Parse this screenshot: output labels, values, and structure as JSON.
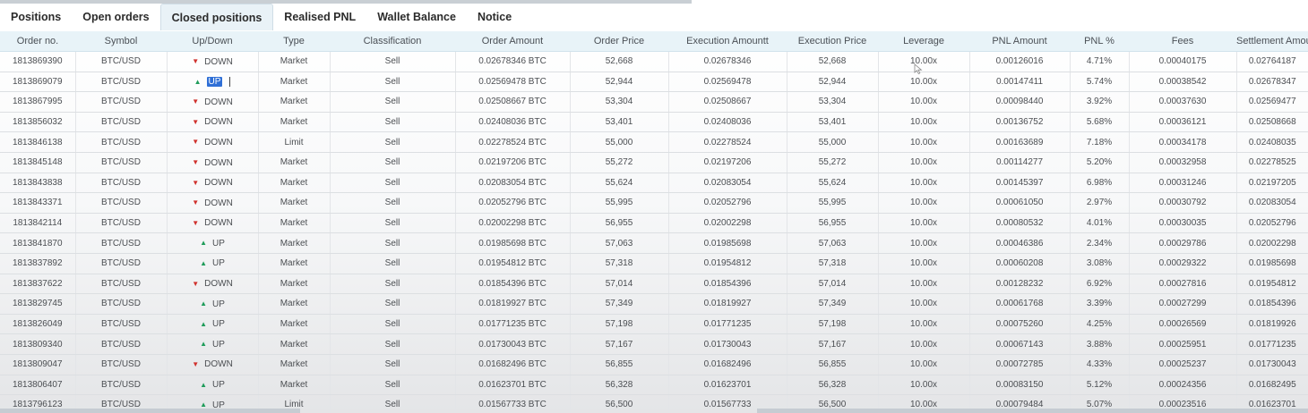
{
  "tabs": [
    {
      "label": "Positions",
      "active": false
    },
    {
      "label": "Open orders",
      "active": false
    },
    {
      "label": "Closed positions",
      "active": true
    },
    {
      "label": "Realised PNL",
      "active": false
    },
    {
      "label": "Wallet Balance",
      "active": false
    },
    {
      "label": "Notice",
      "active": false
    }
  ],
  "columns": [
    "Order no.",
    "Symbol",
    "Up/Down",
    "Type",
    "Classification",
    "Order Amount",
    "Order Price",
    "Execution Amountt",
    "Execution Price",
    "Leverage",
    "PNL Amount",
    "PNL %",
    "Fees",
    "Settlement Amount"
  ],
  "direction_colors": {
    "up": "#1f9c5a",
    "down": "#d0312d"
  },
  "rows": [
    {
      "order_no": "1813869390",
      "symbol": "BTC/USD",
      "dir": "DOWN",
      "type": "Market",
      "classification": "Sell",
      "order_amount": "0.02678346 BTC",
      "order_price": "52,668",
      "exec_amount": "0.02678346",
      "exec_price": "52,668",
      "leverage": "10.00x",
      "pnl_amount": "0.00126016",
      "pnl_pct": "4.71%",
      "fees": "0.00040175",
      "settlement": "0.02764187"
    },
    {
      "order_no": "1813869079",
      "symbol": "BTC/USD",
      "dir": "UP",
      "type": "Market",
      "classification": "Sell",
      "order_amount": "0.02569478 BTC",
      "order_price": "52,944",
      "exec_amount": "0.02569478",
      "exec_price": "52,944",
      "leverage": "10.00x",
      "pnl_amount": "0.00147411",
      "pnl_pct": "5.74%",
      "fees": "0.00038542",
      "settlement": "0.02678347"
    },
    {
      "order_no": "1813867995",
      "symbol": "BTC/USD",
      "dir": "DOWN",
      "type": "Market",
      "classification": "Sell",
      "order_amount": "0.02508667 BTC",
      "order_price": "53,304",
      "exec_amount": "0.02508667",
      "exec_price": "53,304",
      "leverage": "10.00x",
      "pnl_amount": "0.00098440",
      "pnl_pct": "3.92%",
      "fees": "0.00037630",
      "settlement": "0.02569477"
    },
    {
      "order_no": "1813856032",
      "symbol": "BTC/USD",
      "dir": "DOWN",
      "type": "Market",
      "classification": "Sell",
      "order_amount": "0.02408036 BTC",
      "order_price": "53,401",
      "exec_amount": "0.02408036",
      "exec_price": "53,401",
      "leverage": "10.00x",
      "pnl_amount": "0.00136752",
      "pnl_pct": "5.68%",
      "fees": "0.00036121",
      "settlement": "0.02508668"
    },
    {
      "order_no": "1813846138",
      "symbol": "BTC/USD",
      "dir": "DOWN",
      "type": "Limit",
      "classification": "Sell",
      "order_amount": "0.02278524 BTC",
      "order_price": "55,000",
      "exec_amount": "0.02278524",
      "exec_price": "55,000",
      "leverage": "10.00x",
      "pnl_amount": "0.00163689",
      "pnl_pct": "7.18%",
      "fees": "0.00034178",
      "settlement": "0.02408035"
    },
    {
      "order_no": "1813845148",
      "symbol": "BTC/USD",
      "dir": "DOWN",
      "type": "Market",
      "classification": "Sell",
      "order_amount": "0.02197206 BTC",
      "order_price": "55,272",
      "exec_amount": "0.02197206",
      "exec_price": "55,272",
      "leverage": "10.00x",
      "pnl_amount": "0.00114277",
      "pnl_pct": "5.20%",
      "fees": "0.00032958",
      "settlement": "0.02278525"
    },
    {
      "order_no": "1813843838",
      "symbol": "BTC/USD",
      "dir": "DOWN",
      "type": "Market",
      "classification": "Sell",
      "order_amount": "0.02083054 BTC",
      "order_price": "55,624",
      "exec_amount": "0.02083054",
      "exec_price": "55,624",
      "leverage": "10.00x",
      "pnl_amount": "0.00145397",
      "pnl_pct": "6.98%",
      "fees": "0.00031246",
      "settlement": "0.02197205"
    },
    {
      "order_no": "1813843371",
      "symbol": "BTC/USD",
      "dir": "DOWN",
      "type": "Market",
      "classification": "Sell",
      "order_amount": "0.02052796 BTC",
      "order_price": "55,995",
      "exec_amount": "0.02052796",
      "exec_price": "55,995",
      "leverage": "10.00x",
      "pnl_amount": "0.00061050",
      "pnl_pct": "2.97%",
      "fees": "0.00030792",
      "settlement": "0.02083054"
    },
    {
      "order_no": "1813842114",
      "symbol": "BTC/USD",
      "dir": "DOWN",
      "type": "Market",
      "classification": "Sell",
      "order_amount": "0.02002298 BTC",
      "order_price": "56,955",
      "exec_amount": "0.02002298",
      "exec_price": "56,955",
      "leverage": "10.00x",
      "pnl_amount": "0.00080532",
      "pnl_pct": "4.01%",
      "fees": "0.00030035",
      "settlement": "0.02052796"
    },
    {
      "order_no": "1813841870",
      "symbol": "BTC/USD",
      "dir": "UP",
      "type": "Market",
      "classification": "Sell",
      "order_amount": "0.01985698 BTC",
      "order_price": "57,063",
      "exec_amount": "0.01985698",
      "exec_price": "57,063",
      "leverage": "10.00x",
      "pnl_amount": "0.00046386",
      "pnl_pct": "2.34%",
      "fees": "0.00029786",
      "settlement": "0.02002298"
    },
    {
      "order_no": "1813837892",
      "symbol": "BTC/USD",
      "dir": "UP",
      "type": "Market",
      "classification": "Sell",
      "order_amount": "0.01954812 BTC",
      "order_price": "57,318",
      "exec_amount": "0.01954812",
      "exec_price": "57,318",
      "leverage": "10.00x",
      "pnl_amount": "0.00060208",
      "pnl_pct": "3.08%",
      "fees": "0.00029322",
      "settlement": "0.01985698"
    },
    {
      "order_no": "1813837622",
      "symbol": "BTC/USD",
      "dir": "DOWN",
      "type": "Market",
      "classification": "Sell",
      "order_amount": "0.01854396 BTC",
      "order_price": "57,014",
      "exec_amount": "0.01854396",
      "exec_price": "57,014",
      "leverage": "10.00x",
      "pnl_amount": "0.00128232",
      "pnl_pct": "6.92%",
      "fees": "0.00027816",
      "settlement": "0.01954812"
    },
    {
      "order_no": "1813829745",
      "symbol": "BTC/USD",
      "dir": "UP",
      "type": "Market",
      "classification": "Sell",
      "order_amount": "0.01819927 BTC",
      "order_price": "57,349",
      "exec_amount": "0.01819927",
      "exec_price": "57,349",
      "leverage": "10.00x",
      "pnl_amount": "0.00061768",
      "pnl_pct": "3.39%",
      "fees": "0.00027299",
      "settlement": "0.01854396"
    },
    {
      "order_no": "1813826049",
      "symbol": "BTC/USD",
      "dir": "UP",
      "type": "Market",
      "classification": "Sell",
      "order_amount": "0.01771235 BTC",
      "order_price": "57,198",
      "exec_amount": "0.01771235",
      "exec_price": "57,198",
      "leverage": "10.00x",
      "pnl_amount": "0.00075260",
      "pnl_pct": "4.25%",
      "fees": "0.00026569",
      "settlement": "0.01819926"
    },
    {
      "order_no": "1813809340",
      "symbol": "BTC/USD",
      "dir": "UP",
      "type": "Market",
      "classification": "Sell",
      "order_amount": "0.01730043 BTC",
      "order_price": "57,167",
      "exec_amount": "0.01730043",
      "exec_price": "57,167",
      "leverage": "10.00x",
      "pnl_amount": "0.00067143",
      "pnl_pct": "3.88%",
      "fees": "0.00025951",
      "settlement": "0.01771235"
    },
    {
      "order_no": "1813809047",
      "symbol": "BTC/USD",
      "dir": "DOWN",
      "type": "Market",
      "classification": "Sell",
      "order_amount": "0.01682496 BTC",
      "order_price": "56,855",
      "exec_amount": "0.01682496",
      "exec_price": "56,855",
      "leverage": "10.00x",
      "pnl_amount": "0.00072785",
      "pnl_pct": "4.33%",
      "fees": "0.00025237",
      "settlement": "0.01730043"
    },
    {
      "order_no": "1813806407",
      "symbol": "BTC/USD",
      "dir": "UP",
      "type": "Market",
      "classification": "Sell",
      "order_amount": "0.01623701 BTC",
      "order_price": "56,328",
      "exec_amount": "0.01623701",
      "exec_price": "56,328",
      "leverage": "10.00x",
      "pnl_amount": "0.00083150",
      "pnl_pct": "5.12%",
      "fees": "0.00024356",
      "settlement": "0.01682495"
    },
    {
      "order_no": "1813796123",
      "symbol": "BTC/USD",
      "dir": "UP",
      "type": "Limit",
      "classification": "Sell",
      "order_amount": "0.01567733 BTC",
      "order_price": "56,500",
      "exec_amount": "0.01567733",
      "exec_price": "56,500",
      "leverage": "10.00x",
      "pnl_amount": "0.00079484",
      "pnl_pct": "5.07%",
      "fees": "0.00023516",
      "settlement": "0.01623701"
    }
  ]
}
